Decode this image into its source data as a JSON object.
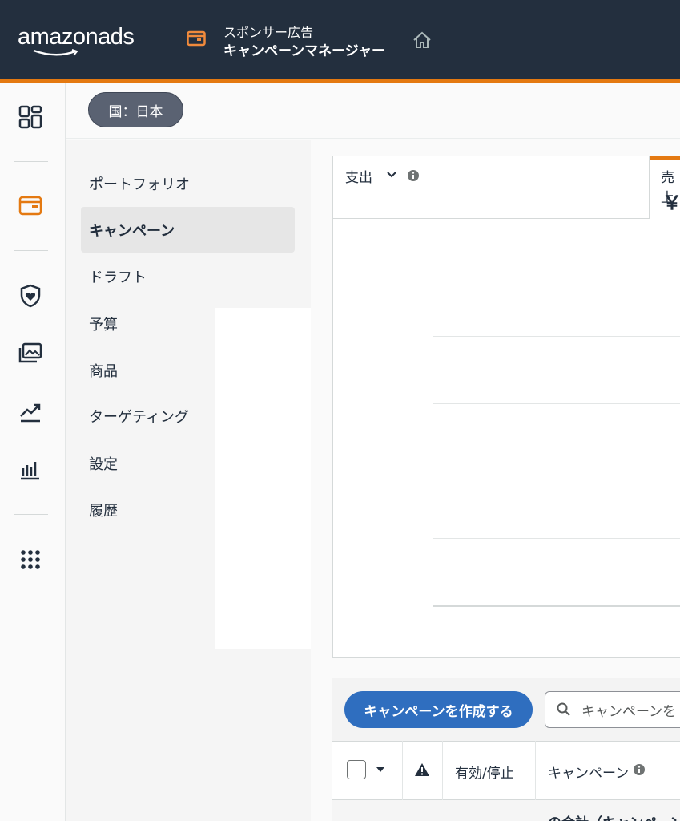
{
  "header": {
    "logo_text": "amazonads",
    "app_subtitle": "スポンサー広告",
    "app_title": "キャンペーンマネージャー"
  },
  "rail": {
    "icons": [
      "dashboard-icon",
      "campaign-wallet-icon",
      "shield-heart-icon",
      "media-gallery-icon",
      "trend-icon",
      "bar-chart-icon",
      "apps-grid-icon"
    ]
  },
  "country": {
    "label": "国：日本"
  },
  "subnav": {
    "items": [
      "ポートフォリオ",
      "キャンペーン",
      "ドラフト",
      "予算",
      "商品",
      "ターゲティング",
      "設定",
      "履歴"
    ],
    "active": "キャンペーン"
  },
  "chart_panel": {
    "metric1_label": "支出",
    "metric2_label": "売上",
    "metric2_value": "￥"
  },
  "table": {
    "create_button": "キャンペーンを作成する",
    "search_placeholder": "キャンペーンを",
    "columns": [
      "有効/停止",
      "キャンペーン"
    ],
    "first_row": "の合計（キャンペーン"
  },
  "colors": {
    "header_bg": "#232f3e",
    "accent_orange": "#e47911",
    "primary_blue": "#2f6ebf"
  }
}
